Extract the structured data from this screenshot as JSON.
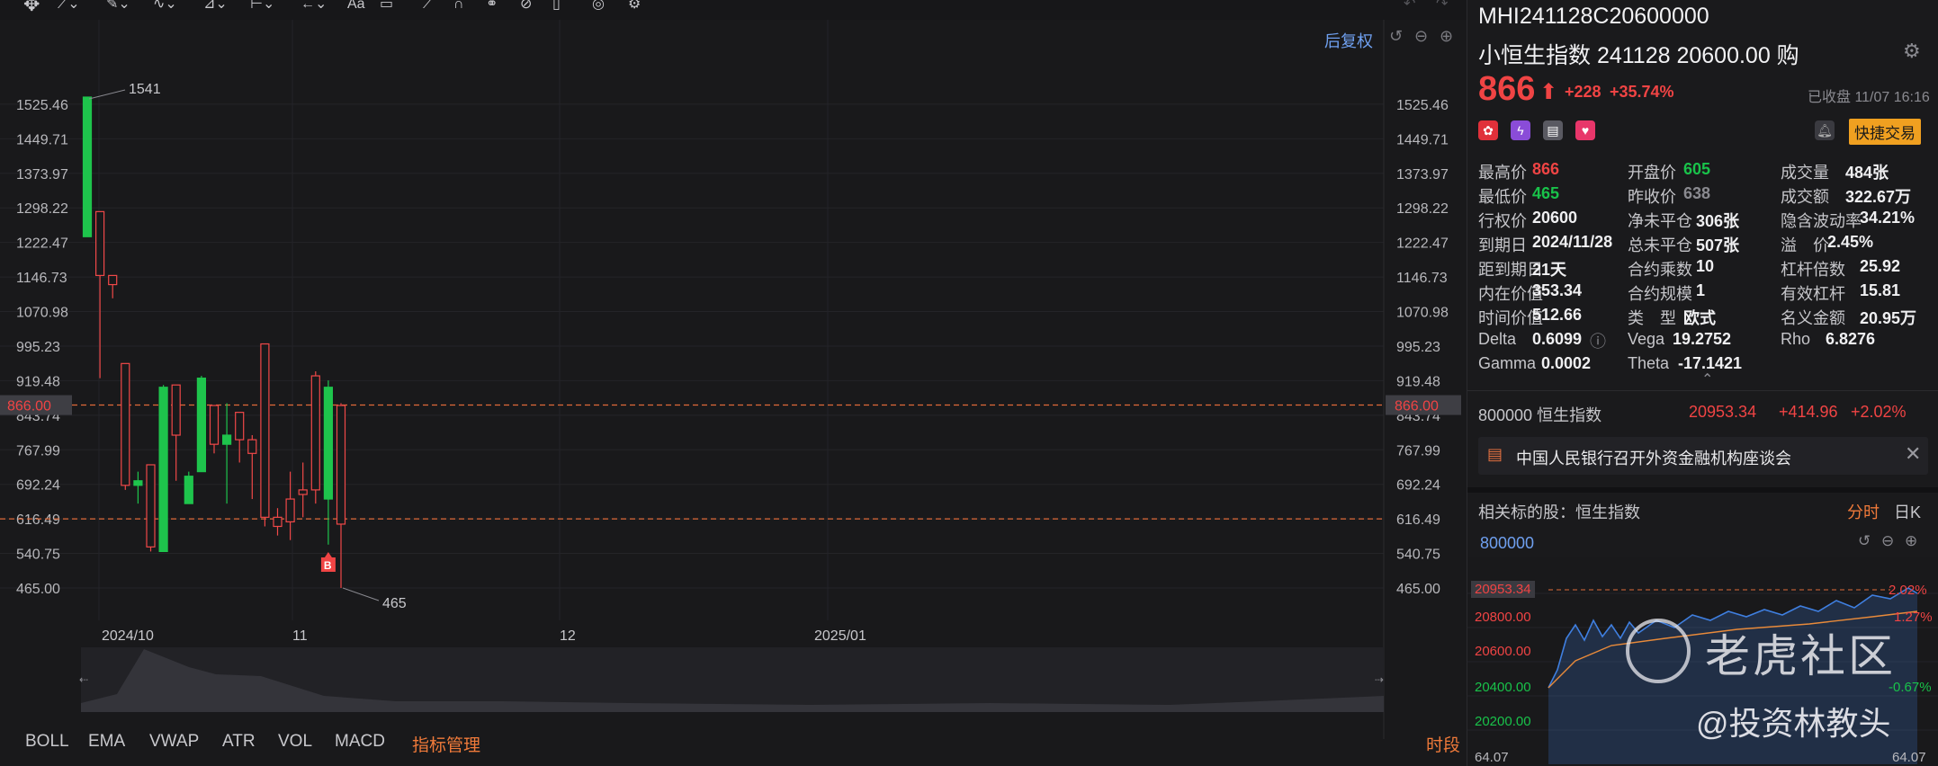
{
  "toolbar": {
    "icons": [
      "move-icon",
      "line-tool-icon",
      "pen-tool-icon",
      "wave-tool-icon",
      "measure-tool-icon",
      "range-tool-icon",
      "arrow-tool-icon",
      "text-tool-icon",
      "comment-tool-icon",
      "ruler-icon",
      "magnet-icon",
      "link-icon",
      "hide-icon",
      "trash-icon",
      "layers-icon",
      "settings-icon"
    ],
    "text_tool_label": "Aa"
  },
  "chart": {
    "adjust_label": "后复权",
    "price_ticks": [
      "1525.46",
      "1449.71",
      "1373.97",
      "1298.22",
      "1222.47",
      "1146.73",
      "1070.98",
      "995.23",
      "919.48",
      "843.74",
      "767.99",
      "692.24",
      "616.49",
      "540.75",
      "465.00"
    ],
    "current_price_tag": "866.00",
    "high_annotation": "1541",
    "low_annotation": "465",
    "buy_marker": "B",
    "date_labels": [
      "2024/10",
      "11",
      "12",
      "2025/01"
    ],
    "colors": {
      "up": "#1ec44c",
      "down": "#f04848",
      "dash": "#e06a3a",
      "grid": "#242428"
    }
  },
  "chart_data": {
    "type": "candlestick",
    "ylim": [
      465,
      1541
    ],
    "candles": [
      {
        "o": 1235,
        "h": 1541,
        "l": 1235,
        "c": 1541
      },
      {
        "o": 1290,
        "h": 1290,
        "l": 925,
        "c": 1150
      },
      {
        "o": 1150,
        "h": 1150,
        "l": 1100,
        "c": 1130
      },
      {
        "o": 957,
        "h": 957,
        "l": 680,
        "c": 690
      },
      {
        "o": 690,
        "h": 720,
        "l": 650,
        "c": 700
      },
      {
        "o": 735,
        "h": 735,
        "l": 545,
        "c": 555
      },
      {
        "o": 545,
        "h": 910,
        "l": 545,
        "c": 905
      },
      {
        "o": 910,
        "h": 910,
        "l": 700,
        "c": 800
      },
      {
        "o": 650,
        "h": 720,
        "l": 650,
        "c": 710
      },
      {
        "o": 720,
        "h": 930,
        "l": 720,
        "c": 925
      },
      {
        "o": 865,
        "h": 865,
        "l": 760,
        "c": 780
      },
      {
        "o": 780,
        "h": 870,
        "l": 650,
        "c": 800
      },
      {
        "o": 850,
        "h": 850,
        "l": 740,
        "c": 790
      },
      {
        "o": 790,
        "h": 800,
        "l": 660,
        "c": 760
      },
      {
        "o": 1000,
        "h": 1000,
        "l": 600,
        "c": 620
      },
      {
        "o": 620,
        "h": 640,
        "l": 580,
        "c": 600
      },
      {
        "o": 660,
        "h": 720,
        "l": 570,
        "c": 610
      },
      {
        "o": 680,
        "h": 740,
        "l": 620,
        "c": 670
      },
      {
        "o": 930,
        "h": 940,
        "l": 650,
        "c": 680
      },
      {
        "o": 660,
        "h": 920,
        "l": 560,
        "c": 905
      },
      {
        "o": 865,
        "h": 870,
        "l": 465,
        "c": 605
      }
    ],
    "current": 866,
    "reference_line": 616.49
  },
  "indicators": {
    "tabs": [
      "BOLL",
      "EMA",
      "VWAP",
      "ATR",
      "VOL",
      "MACD"
    ],
    "manage_label": "指标管理",
    "period_label": "时段"
  },
  "quote": {
    "code": "MHI241128C20600000",
    "name": "小恒生指数 241128 20600.00 购",
    "price": "866",
    "arrow": "⬆",
    "change": "+228",
    "change_pct": "+35.74%",
    "status": "已收盘 11/07 16:16",
    "quick_trade": "快捷交易",
    "fields": [
      [
        {
          "l": "最高价",
          "v": "866",
          "c": "red"
        },
        {
          "l": "开盘价",
          "v": "605",
          "c": "green"
        },
        {
          "l": "成交量",
          "v": "484张",
          "c": ""
        }
      ],
      [
        {
          "l": "最低价",
          "v": "465",
          "c": "green"
        },
        {
          "l": "昨收价",
          "v": "638",
          "c": "muted"
        },
        {
          "l": "成交额",
          "v": "322.67万",
          "c": ""
        }
      ],
      [
        {
          "l": "行权价",
          "v": "20600",
          "c": ""
        },
        {
          "l": "净未平仓",
          "v": "306张",
          "c": ""
        },
        {
          "l": "隐含波动率",
          "v": "34.21%",
          "c": ""
        }
      ],
      [
        {
          "l": "到期日",
          "v": "2024/11/28",
          "c": ""
        },
        {
          "l": "总未平仓",
          "v": "507张",
          "c": ""
        },
        {
          "l": "溢　价",
          "v": "2.45%",
          "c": ""
        }
      ],
      [
        {
          "l": "距到期日",
          "v": "21天",
          "c": ""
        },
        {
          "l": "合约乘数",
          "v": "10",
          "c": ""
        },
        {
          "l": "杠杆倍数",
          "v": "25.92",
          "c": ""
        }
      ],
      [
        {
          "l": "内在价值",
          "v": "353.34",
          "c": ""
        },
        {
          "l": "合约规模",
          "v": "1",
          "c": ""
        },
        {
          "l": "有效杠杆",
          "v": "15.81",
          "c": ""
        }
      ],
      [
        {
          "l": "时间价值",
          "v": "512.66",
          "c": ""
        },
        {
          "l": "类　型",
          "v": "欧式",
          "c": ""
        },
        {
          "l": "名义金额",
          "v": "20.95万",
          "c": ""
        }
      ],
      [
        {
          "l": "Delta",
          "v": "0.6099",
          "c": ""
        },
        {
          "l": "Vega",
          "v": "19.2752",
          "c": ""
        },
        {
          "l": "Rho",
          "v": "6.8276",
          "c": ""
        }
      ],
      [
        {
          "l": "Gamma",
          "v": "0.0002",
          "c": ""
        },
        {
          "l": "Theta",
          "v": "-17.1421",
          "c": ""
        },
        {
          "l": "",
          "v": "",
          "c": ""
        }
      ]
    ],
    "underlying": {
      "code": "800000",
      "name": "恒生指数",
      "price": "20953.34",
      "change": "+414.96",
      "pct": "+2.02%"
    },
    "news": "中国人民银行召开外资金融机构座谈会",
    "related_label": "相关标的股：",
    "related_name": "恒生指数",
    "tab_minute": "分时",
    "tab_daily": "日K",
    "mini_code": "800000"
  },
  "mini_chart": {
    "left_ticks": [
      "20800.00",
      "20600.00",
      "20400.00",
      "20200.00",
      "64.07"
    ],
    "right_ticks": [
      "2.02%",
      "1.27%",
      "-0.67%",
      "64.07"
    ],
    "current_tag": "20953.34",
    "line_color": "#3f7fe0",
    "avg_color": "#e88a3a"
  },
  "watermark": {
    "brand": "老虎社区",
    "handle": "@投资林教头"
  }
}
